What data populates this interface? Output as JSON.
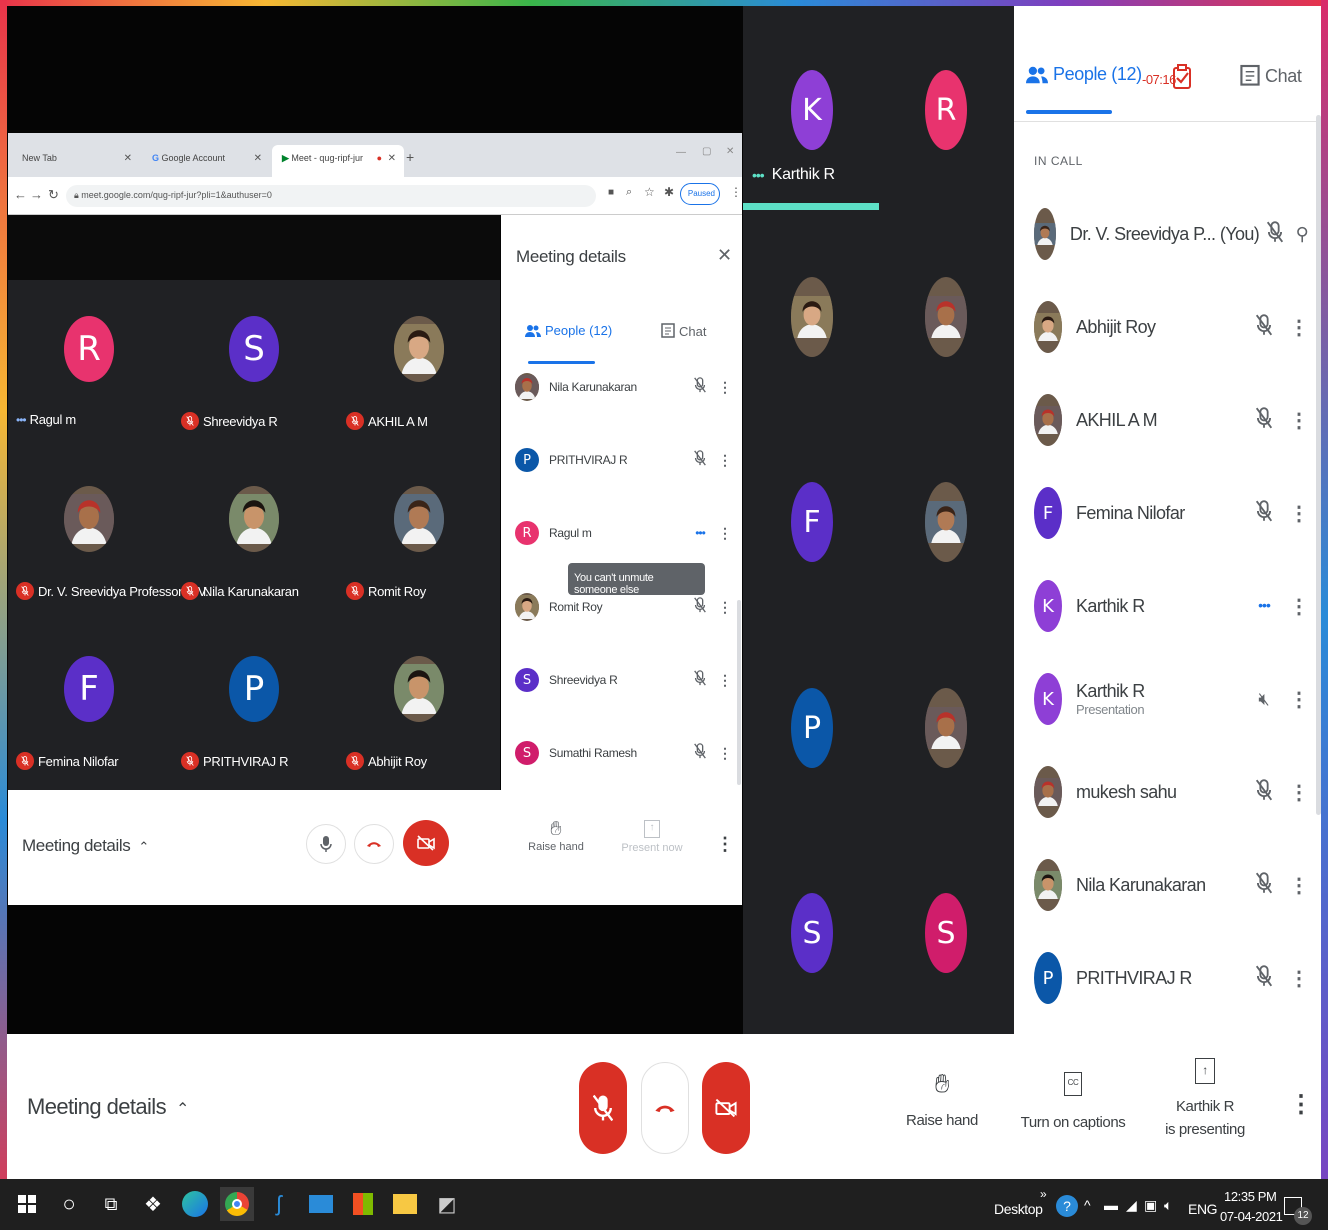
{
  "browser": {
    "tabs": [
      "New Tab",
      "Google Account",
      "Meet - qug-ripf-jur"
    ],
    "url": "meet.google.com/qug-ripf-jur?pli=1&authuser=0",
    "paused_label": "Paused"
  },
  "inner_grid": [
    {
      "name": "Ragul m",
      "initial": "R",
      "color": "#e8336e",
      "status": "speaking"
    },
    {
      "name": "Shreevidya R",
      "initial": "S",
      "color": "#5b2fc8",
      "status": "muted"
    },
    {
      "name": "AKHIL A M",
      "initial": "",
      "color": "",
      "status": "muted"
    },
    {
      "name": "Dr. V. Sreevidya Professor CIV...",
      "initial": "",
      "color": "",
      "status": "muted"
    },
    {
      "name": "Nila Karunakaran",
      "initial": "",
      "color": "",
      "status": "muted"
    },
    {
      "name": "Romit Roy",
      "initial": "",
      "color": "",
      "status": "muted"
    },
    {
      "name": "Femina Nilofar",
      "initial": "F",
      "color": "#5b2fc8",
      "status": "muted"
    },
    {
      "name": "PRITHVIRAJ R",
      "initial": "P",
      "color": "#0b57a8",
      "status": "muted"
    },
    {
      "name": "Abhijit Roy",
      "initial": "",
      "color": "",
      "status": "muted"
    }
  ],
  "meeting_details_panel": {
    "title": "Meeting details",
    "people_tab": "People (12)",
    "chat_tab": "Chat",
    "rows": [
      {
        "name": "Nila Karunakaran",
        "initial": "",
        "color": "",
        "state": "muted"
      },
      {
        "name": "PRITHVIRAJ R",
        "initial": "P",
        "color": "#0b57a8",
        "state": "muted"
      },
      {
        "name": "Ragul m",
        "initial": "R",
        "color": "#e8336e",
        "state": "speaking"
      },
      {
        "name": "Romit Roy",
        "initial": "",
        "color": "",
        "state": "muted"
      },
      {
        "name": "Shreevidya R",
        "initial": "S",
        "color": "#5b2fc8",
        "state": "muted"
      },
      {
        "name": "Sumathi Ramesh",
        "initial": "S",
        "color": "#d01d6b",
        "state": "muted"
      }
    ],
    "tooltip": "You can't unmute someone else"
  },
  "inner_bottom": {
    "details_label": "Meeting details",
    "raise_hand": "Raise hand",
    "present_now": "Present now"
  },
  "mid_column": {
    "presenter_label": "Karthik R",
    "tiles": [
      {
        "initial": "K",
        "color": "#8e3fd6"
      },
      {
        "initial": "R",
        "color": "#e8336e"
      },
      {
        "initial": "",
        "color": ""
      },
      {
        "initial": "",
        "color": ""
      },
      {
        "initial": "F",
        "color": "#5b2fc8"
      },
      {
        "initial": "",
        "color": ""
      },
      {
        "initial": "P",
        "color": "#0b57a8"
      },
      {
        "initial": "",
        "color": ""
      },
      {
        "initial": "S",
        "color": "#5b2fc8"
      },
      {
        "initial": "S",
        "color": "#d01d6b"
      }
    ]
  },
  "people_panel": {
    "people_tab": "People (12)",
    "timer": "-07:16",
    "chat_tab": "Chat",
    "section_label": "IN CALL",
    "rows": [
      {
        "name": "Dr. V. Sreevidya P...",
        "suffix": "(You)",
        "sub": "",
        "initial": "",
        "color": "",
        "state": "muted",
        "action": "pin"
      },
      {
        "name": "Abhijit Roy",
        "suffix": "",
        "sub": "",
        "initial": "",
        "color": "",
        "state": "muted",
        "action": "more"
      },
      {
        "name": "AKHIL A M",
        "suffix": "",
        "sub": "",
        "initial": "",
        "color": "",
        "state": "muted",
        "action": "more"
      },
      {
        "name": "Femina Nilofar",
        "suffix": "",
        "sub": "",
        "initial": "F",
        "color": "#5b2fc8",
        "state": "muted",
        "action": "more"
      },
      {
        "name": "Karthik R",
        "suffix": "",
        "sub": "",
        "initial": "K",
        "color": "#8e3fd6",
        "state": "speaking",
        "action": "more"
      },
      {
        "name": "Karthik R",
        "suffix": "",
        "sub": "Presentation",
        "initial": "K",
        "color": "#8e3fd6",
        "state": "volume-off",
        "action": "more"
      },
      {
        "name": "mukesh sahu",
        "suffix": "",
        "sub": "",
        "initial": "",
        "color": "",
        "state": "muted",
        "action": "more"
      },
      {
        "name": "Nila Karunakaran",
        "suffix": "",
        "sub": "",
        "initial": "",
        "color": "",
        "state": "muted",
        "action": "more"
      },
      {
        "name": "PRITHVIRAJ R",
        "suffix": "",
        "sub": "",
        "initial": "P",
        "color": "#0b57a8",
        "state": "muted",
        "action": "more"
      }
    ]
  },
  "bottom_bar": {
    "details_label": "Meeting details",
    "raise_hand": "Raise hand",
    "captions": "Turn on captions",
    "presenting_line1": "Karthik R",
    "presenting_line2": "is presenting"
  },
  "taskbar": {
    "desktop_label": "Desktop",
    "lang": "ENG",
    "time": "12:35 PM",
    "date": "07-04-2021",
    "notifications": "12"
  },
  "colors": {
    "red": "#d93025",
    "blue": "#1a73e8",
    "teal": "#5de0c6"
  }
}
